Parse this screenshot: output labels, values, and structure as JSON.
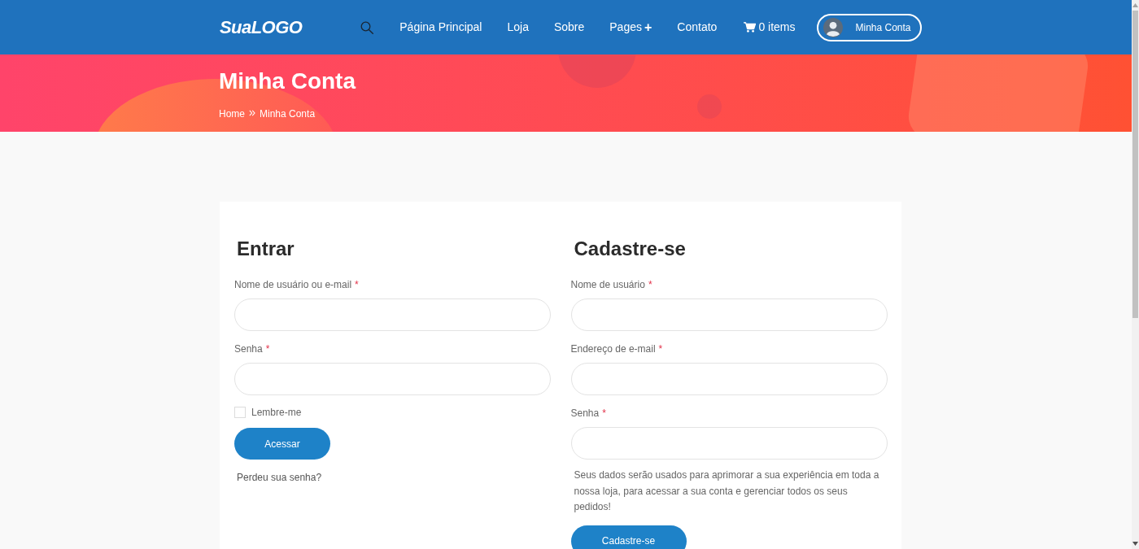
{
  "header": {
    "logo": "SuaLOGO",
    "nav": [
      {
        "label": "Página Principal"
      },
      {
        "label": "Loja"
      },
      {
        "label": "Sobre"
      },
      {
        "label": "Pages",
        "submenu_mark": "+"
      },
      {
        "label": "Contato"
      }
    ],
    "cart": "0 items",
    "account_button": "Minha Conta"
  },
  "banner": {
    "title": "Minha Conta",
    "breadcrumb": [
      {
        "label": "Home"
      },
      {
        "label": "Minha Conta"
      }
    ]
  },
  "login": {
    "title": "Entrar",
    "fields": [
      {
        "label": "Nome de usuário ou e-mail",
        "required_mark": "*"
      },
      {
        "label": "Senha",
        "required_mark": "*"
      }
    ],
    "remember": {
      "label": "Lembre-me",
      "checked": false
    },
    "submit": "Acessar",
    "lost_password": "Perdeu sua senha?"
  },
  "register": {
    "title": "Cadastre-se",
    "fields": [
      {
        "label": "Nome de usuário",
        "required_mark": "*"
      },
      {
        "label": "Endereço de e-mail",
        "required_mark": "*"
      },
      {
        "label": "Senha",
        "required_mark": "*"
      }
    ],
    "privacy_text": "Seus dados serão usados para aprimorar a sua experiência em toda a nossa loja, para acessar a sua conta e gerenciar todos os seus pedidos!",
    "submit": "Cadastre-se"
  }
}
